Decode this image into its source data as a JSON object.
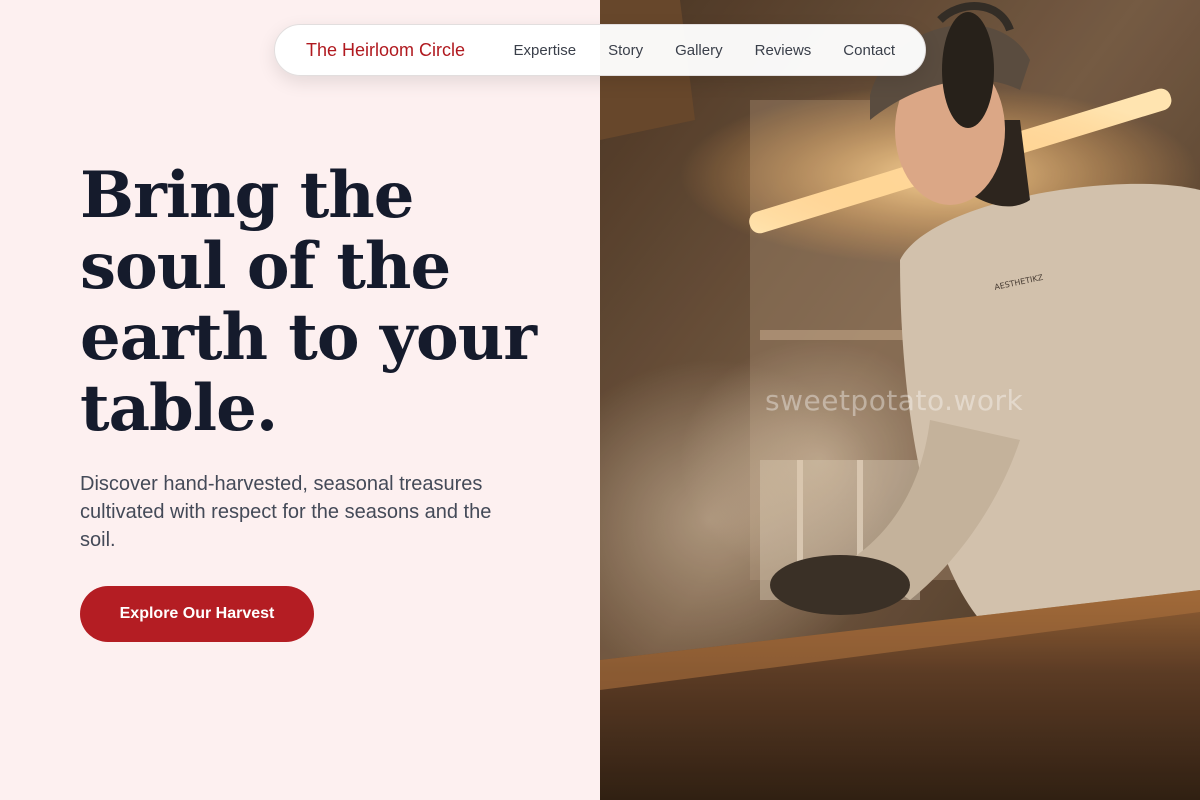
{
  "nav": {
    "brand": "The Heirloom Circle",
    "links": [
      "Expertise",
      "Story",
      "Gallery",
      "Reviews",
      "Contact"
    ]
  },
  "hero": {
    "headline": "Bring the soul of the earth to your table.",
    "subheadline": "Discover hand-harvested, seasonal treasures cultivated with respect for the seasons and the soil.",
    "cta_label": "Explore Our Harvest"
  },
  "photo": {
    "watermark": "sweetpotato.work",
    "sweatshirt_print": "AESTHETIKZ"
  },
  "colors": {
    "accent": "#b41d23",
    "brand_text": "#b0191f",
    "background": "#fdf0f0",
    "heading": "#151b2c",
    "body_text": "#444a58"
  }
}
